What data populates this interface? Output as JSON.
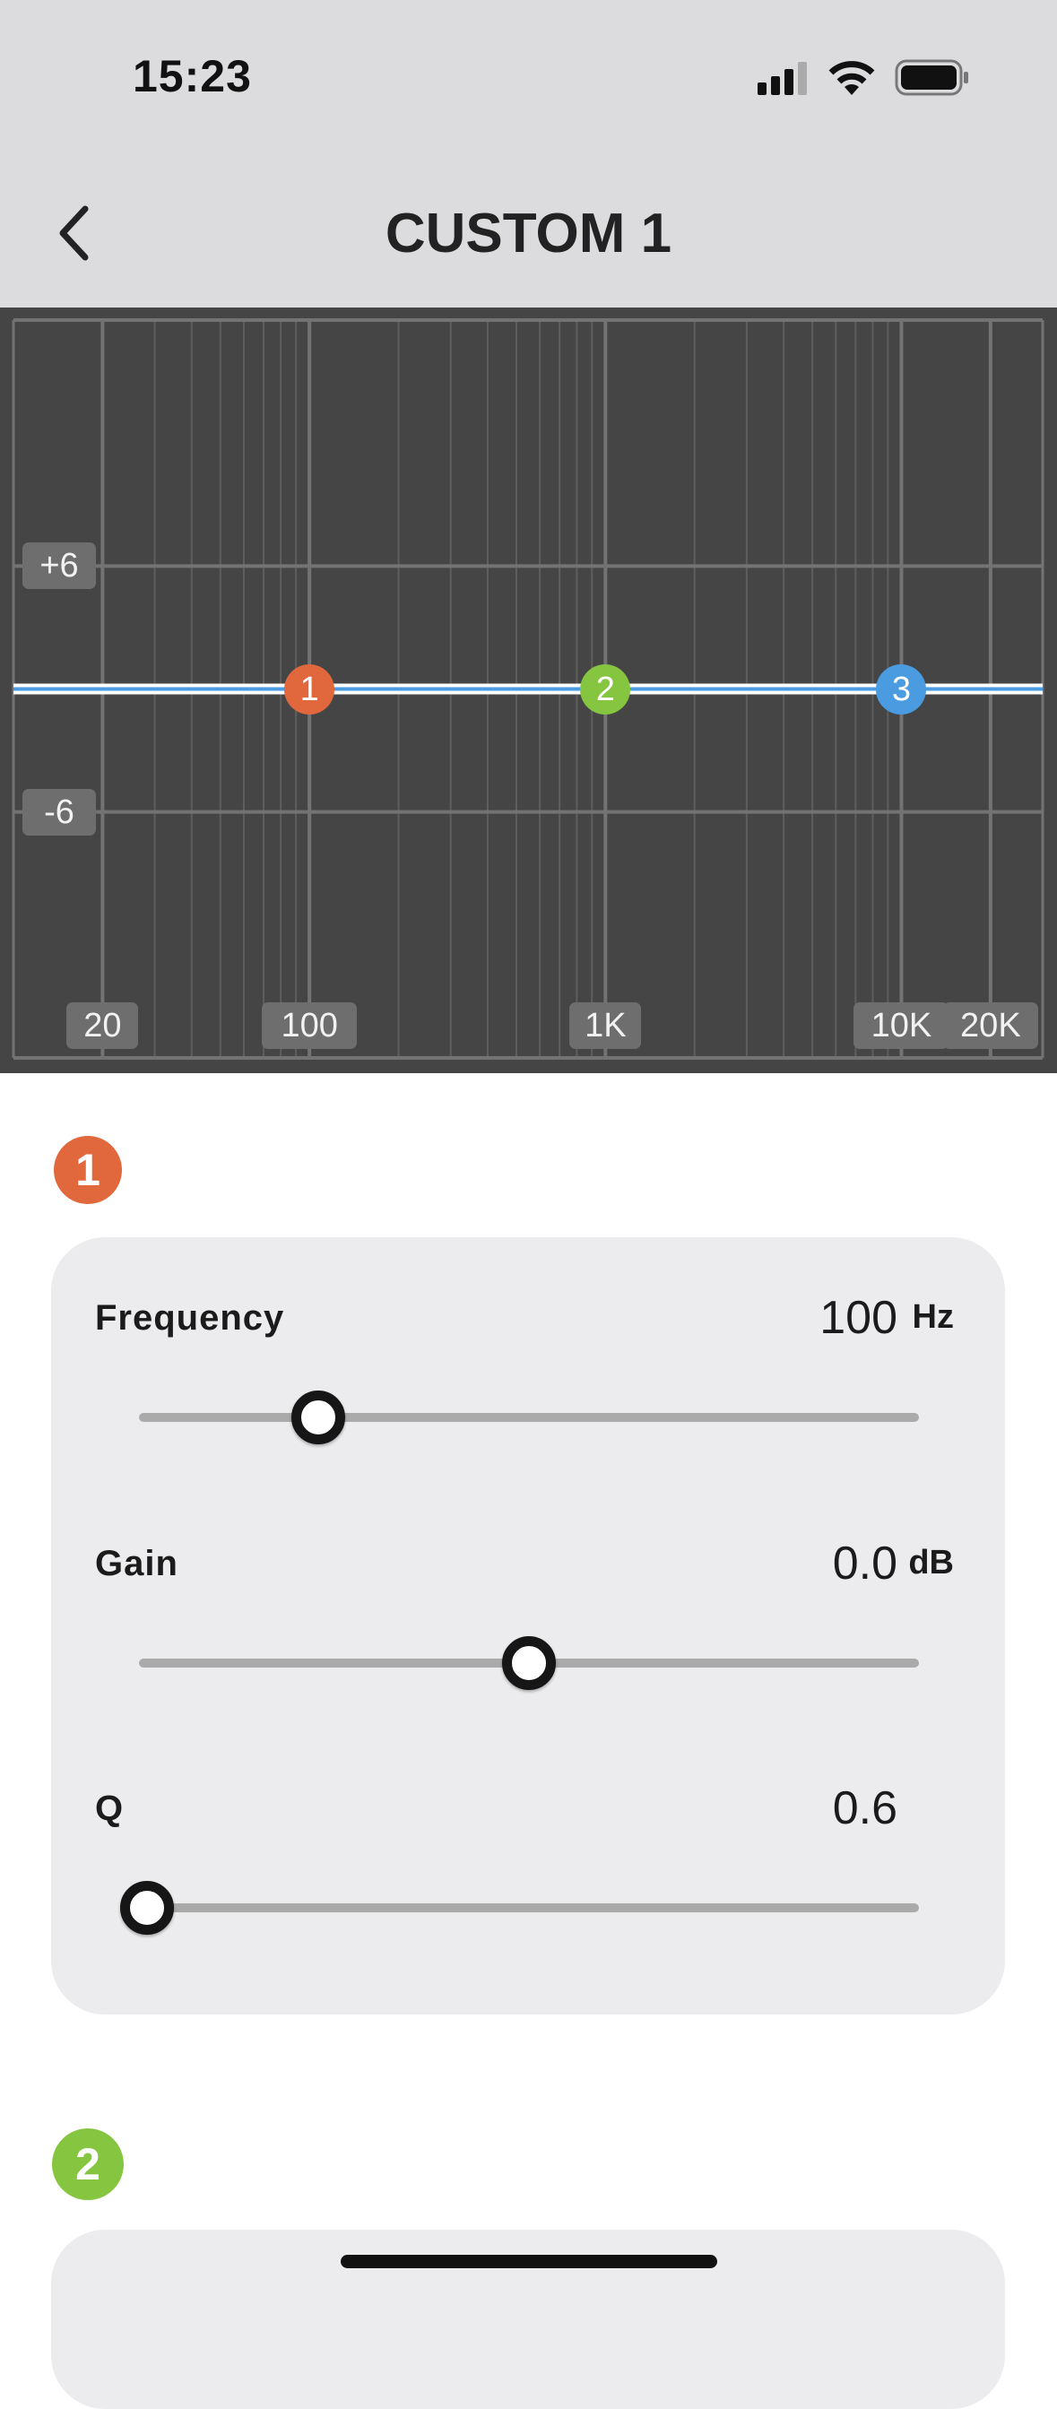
{
  "status_bar": {
    "time": "15:23",
    "icons": [
      "cellular-signal-icon",
      "wifi-icon",
      "battery-icon"
    ]
  },
  "header": {
    "title": "CUSTOM 1",
    "back_icon": "chevron-left-icon"
  },
  "chart_data": {
    "type": "line",
    "x_scale": "log",
    "x_ticks": [
      {
        "value": 20,
        "label": "20"
      },
      {
        "value": 100,
        "label": "100"
      },
      {
        "value": 1000,
        "label": "1K"
      },
      {
        "value": 10000,
        "label": "10K"
      },
      {
        "value": 20000,
        "label": "20K"
      }
    ],
    "y_ticks": [
      {
        "value": 6,
        "label": "+6"
      },
      {
        "value": -6,
        "label": "-6"
      }
    ],
    "ylim": [
      -18,
      18
    ],
    "xlim": [
      10,
      30000
    ],
    "grid": true,
    "curve_gain_db": 0,
    "bands": [
      {
        "label": "1",
        "freq": 100,
        "gain": 0,
        "color": "#e0683c"
      },
      {
        "label": "2",
        "freq": 1000,
        "gain": 0,
        "color": "#86c540"
      },
      {
        "label": "3",
        "freq": 10000,
        "gain": 0,
        "color": "#4a9be0"
      }
    ]
  },
  "band1": {
    "number": "1",
    "color": "#e0683c",
    "frequency": {
      "label": "Frequency",
      "value": "100",
      "unit": "Hz",
      "slider_fraction": 0.23
    },
    "gain": {
      "label": "Gain",
      "value": "0.0",
      "unit": "dB",
      "slider_fraction": 0.5
    },
    "q": {
      "label": "Q",
      "value": "0.6",
      "slider_fraction": 0.01
    }
  },
  "band2": {
    "number": "2",
    "color": "#86c540"
  }
}
